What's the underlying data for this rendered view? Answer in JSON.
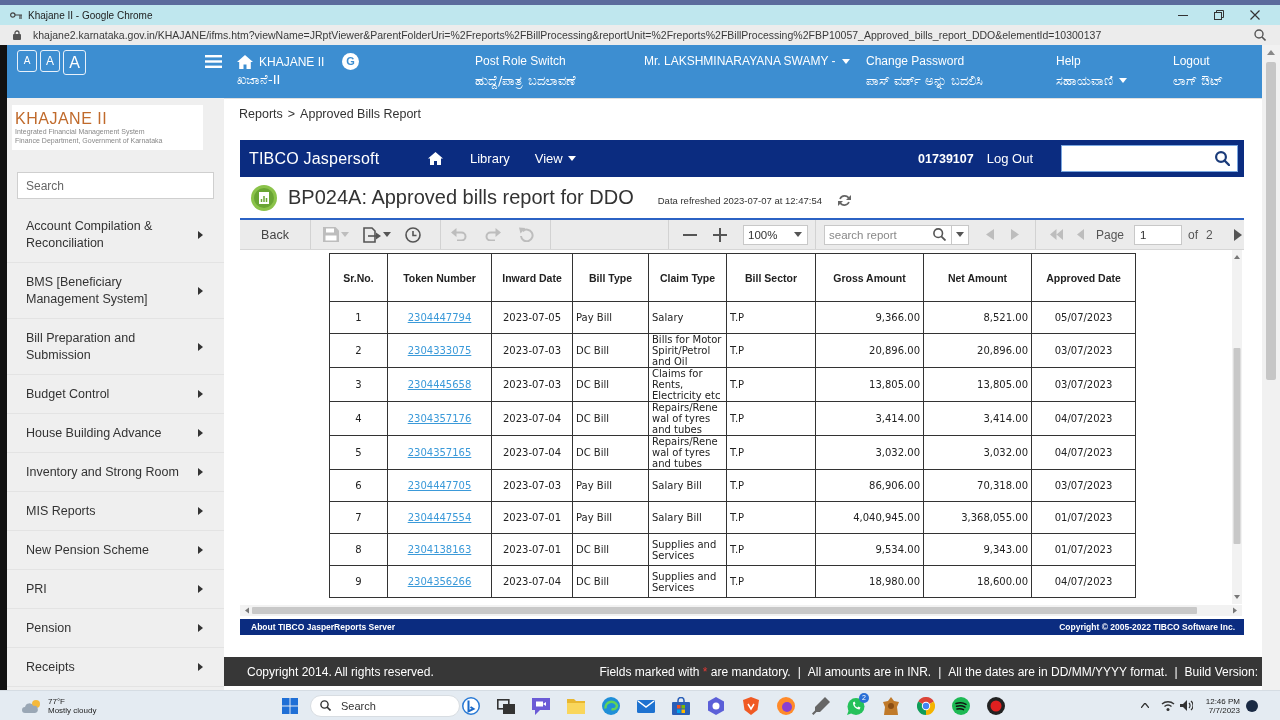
{
  "browser": {
    "title": "Khajane II - Google Chrome",
    "url": "khajane2.karnataka.gov.in/KHAJANE/ifms.htm?viewName=JRptViewer&ParentFolderUri=%2Freports%2FBillProcessing&reportUnit=%2Freports%2FBillProcessing%2FBP10057_Approved_bills_report_DDO&elementId=10300137"
  },
  "header": {
    "font_sizes": [
      "A",
      "A",
      "A"
    ],
    "brand": {
      "title": "KHAJANE II",
      "subtitle": "ಖಜಾನೆ-II"
    },
    "translate": "G",
    "links": [
      {
        "label": "Post Role Switch",
        "label_kn": "ಹುದ್ದೆ/ಪಾತ್ರ ಬದಲಾವಣೆ",
        "dropdown": false
      },
      {
        "label": "Mr. LAKSHMINARAYANA SWAMY -",
        "dropdown": true
      },
      {
        "label": "Change Password",
        "label_kn": "ಪಾಸ್ ವರ್ಡ್ ಅನ್ನು ಬದಲಿಸಿ",
        "dropdown": false
      },
      {
        "label": "Help",
        "label_kn": "ಸಹಾಯವಾಣಿ",
        "dropdown": true
      },
      {
        "label": "Logout",
        "label_kn": "ಲಾಗ್ ಔಟ್",
        "dropdown": false
      }
    ]
  },
  "sidebar": {
    "logo": {
      "title": "KHAJANE II",
      "subtitle": [
        "Integrated Financial Management System",
        "Finance Department, Government of Karnataka"
      ]
    },
    "search": {
      "placeholder": "Search"
    },
    "items": [
      "Account Compilation & Reconciliation",
      "BMS [Beneficiary Management System]",
      "Bill Preparation and Submission",
      "Budget Control",
      "House Building Advance",
      "Inventory and Strong Room",
      "MIS Reports",
      "New Pension Scheme",
      "PRI",
      "Pension",
      "Receipts"
    ]
  },
  "breadcrumb": {
    "items": [
      "Reports",
      "Approved Bills Report"
    ],
    "separator": ">"
  },
  "jasper": {
    "logo": "TIBCO Jaspersoft",
    "nav": [
      {
        "label": "Library",
        "dropdown": false
      },
      {
        "label": "View",
        "dropdown": true
      }
    ],
    "user": "01739107",
    "logout": "Log Out"
  },
  "report": {
    "title": "BP024A: Approved bills report for DDO",
    "refreshed": "Data refreshed 2023-07-07 at 12:47:54"
  },
  "toolbar": {
    "back": "Back",
    "tools": [
      {
        "kind": "save",
        "disabled": true,
        "menu": true
      },
      {
        "kind": "export",
        "disabled": false,
        "menu": true
      },
      {
        "kind": "clock",
        "disabled": false,
        "menu": false
      }
    ],
    "history": [
      {
        "kind": "undo",
        "disabled": true
      },
      {
        "kind": "redo",
        "disabled": true
      },
      {
        "kind": "undo_all",
        "disabled": true
      }
    ],
    "zoom": {
      "buttons": [
        {
          "kind": "zoom_out",
          "disabled": false
        },
        {
          "kind": "zoom_in",
          "disabled": false
        }
      ],
      "value": "100%"
    },
    "search": {
      "placeholder": "search report",
      "nav": [
        {
          "kind": "prev",
          "disabled": true
        },
        {
          "kind": "next",
          "disabled": true
        }
      ]
    },
    "paging": {
      "buttons": [
        {
          "kind": "first",
          "disabled": true
        },
        {
          "kind": "prev",
          "disabled": true
        },
        {
          "kind": "next",
          "disabled": false
        }
      ],
      "label": "Page",
      "value": "1",
      "of": "of",
      "total": "2"
    }
  },
  "table": {
    "columns": [
      {
        "label": "Sr.No.",
        "kind": "index"
      },
      {
        "label": "Token Number",
        "kind": "link"
      },
      {
        "label": "Inward Date",
        "kind": "date"
      },
      {
        "label": "Bill Type",
        "kind": "text"
      },
      {
        "label": "Claim Type",
        "kind": "text"
      },
      {
        "label": "Bill Sector",
        "kind": "text"
      },
      {
        "label": "Gross Amount",
        "kind": "amount"
      },
      {
        "label": "Net Amount",
        "kind": "amount"
      },
      {
        "label": "Approved Date",
        "kind": "date"
      }
    ],
    "rows": [
      [
        "1",
        "2304447794",
        "2023-07-05",
        "Pay Bill",
        "Salary",
        "T.P",
        "9,366.00",
        "8,521.00",
        "05/07/2023"
      ],
      [
        "2",
        "2304333075",
        "2023-07-03",
        "DC Bill",
        "Bills for Motor Spirit/Petrol and Oil",
        "T.P",
        "20,896.00",
        "20,896.00",
        "03/07/2023"
      ],
      [
        "3",
        "2304445658",
        "2023-07-03",
        "DC Bill",
        "Claims for Rents, Electricity etc",
        "T.P",
        "13,805.00",
        "13,805.00",
        "03/07/2023"
      ],
      [
        "4",
        "2304357176",
        "2023-07-04",
        "DC Bill",
        "Repairs/Renewal of tyres and tubes",
        "T.P",
        "3,414.00",
        "3,414.00",
        "04/07/2023"
      ],
      [
        "5",
        "2304357165",
        "2023-07-04",
        "DC Bill",
        "Repairs/Renewal of tyres and tubes",
        "T.P",
        "3,032.00",
        "3,032.00",
        "04/07/2023"
      ],
      [
        "6",
        "2304447705",
        "2023-07-03",
        "Pay Bill",
        "Salary Bill",
        "T.P",
        "86,906.00",
        "70,318.00",
        "03/07/2023"
      ],
      [
        "7",
        "2304447554",
        "2023-07-01",
        "Pay Bill",
        "Salary Bill",
        "T.P",
        "4,040,945.00",
        "3,368,055.00",
        "01/07/2023"
      ],
      [
        "8",
        "2304138163",
        "2023-07-01",
        "DC Bill",
        "Supplies and Services",
        "T.P",
        "9,534.00",
        "9,343.00",
        "01/07/2023"
      ],
      [
        "9",
        "2304356266",
        "2023-07-04",
        "DC Bill",
        "Supplies and Services",
        "T.P",
        "18,980.00",
        "18,600.00",
        "04/07/2023"
      ]
    ]
  },
  "jasper_footer": {
    "left": "About TIBCO JasperReports Server",
    "right": "Copyright © 2005-2022 TIBCO Software Inc."
  },
  "footer": {
    "copyright": "Copyright 2014. All rights reserved.",
    "mandatory": {
      "before": "Fields marked with",
      "mark": "*",
      "after": "are mandatory."
    },
    "notes": [
      "All amounts are in INR.",
      "All the dates are in DD/MM/YYYY format.",
      "Build Version:"
    ],
    "separator": "|"
  },
  "taskbar": {
    "weather": {
      "temp": "77°F",
      "condition": "Mostly cloudy"
    },
    "search": "Search",
    "apps": [
      {
        "kind": "b_logo"
      },
      {
        "kind": "task_view"
      },
      {
        "kind": "chat"
      },
      {
        "kind": "folder"
      },
      {
        "kind": "swirl"
      },
      {
        "kind": "mail"
      },
      {
        "kind": "bag"
      },
      {
        "kind": "hexagon"
      },
      {
        "kind": "shield"
      },
      {
        "kind": "flame"
      },
      {
        "kind": "pen"
      },
      {
        "kind": "phone",
        "badge": "2"
      },
      {
        "kind": "emblem"
      },
      {
        "kind": "circle_logo"
      },
      {
        "kind": "waves"
      },
      {
        "kind": "record"
      }
    ],
    "time": "12:46 PM",
    "date": "7/7/2023"
  }
}
